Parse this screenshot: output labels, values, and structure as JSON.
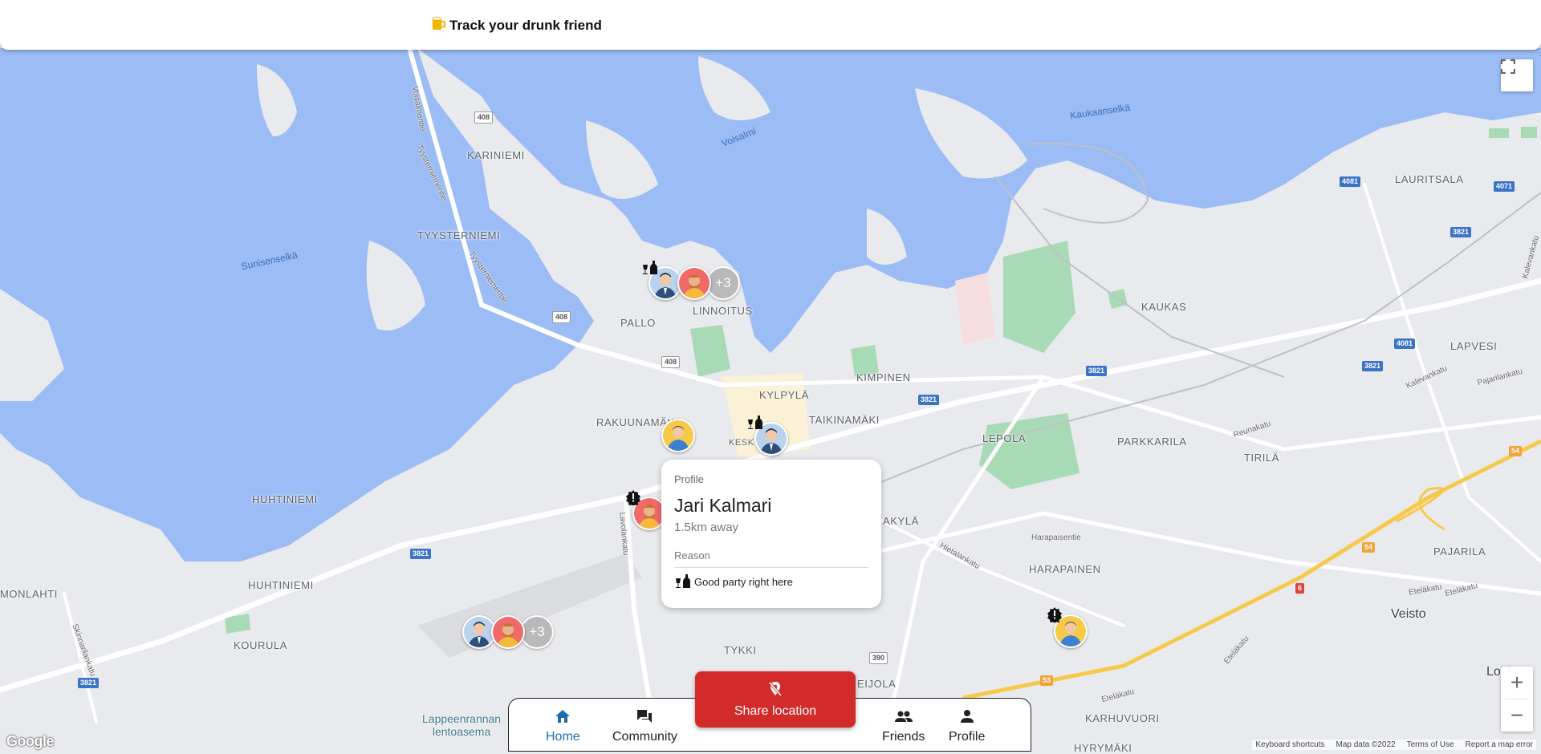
{
  "header": {
    "title": "Track your drunk friend",
    "icon": "beer-mug-icon"
  },
  "map": {
    "places": {
      "karinniemi": "KARINIEMI",
      "tyysterniemi": "TYYSTERNIEMI",
      "pallo": "PALLO",
      "linnoitus": "LINNOITUS",
      "kylpyla": "KYLPYLÄ",
      "kimpinen": "KIMPINEN",
      "rakuunamaki": "RAKUUNAMÄKI",
      "taikinamaki": "TAIKINAMÄKI",
      "keskusta": "KESKU",
      "lepola": "LEPOLA",
      "parkkarila": "PARKKARILA",
      "tirila": "TIRILÄ",
      "huhtiniemi_n": "HUHTINIEMI",
      "huhtiniemi_s": "HUHTINIEMI",
      "monlahti": "MONLAHTI",
      "kourula": "KOURULA",
      "tykki": "TYKKI",
      "eijola": "EIJOLA",
      "akyla": "AKYLÄ",
      "harapainen": "HARAPAINEN",
      "kaukas": "KAUKAS",
      "lauritsala": "LAURITSALA",
      "lapvesi": "LAPVESI",
      "pajarila": "PAJARILA",
      "karhuvuori": "KARHUVUORI",
      "hyrymaki": "HYRYMÄKI",
      "veisto": "Veisto",
      "loiri": "Loiri",
      "airport_line1": "Lappeenrannan",
      "airport_line2": "lentoasema"
    },
    "water": {
      "sunisenselka": "Sunisenselkä",
      "voisalmi": "Voisalmi",
      "kaukaanselka": "Kaukaanselkä"
    },
    "roads": {
      "voisalmentie": "Voisalmentie",
      "tyysterniementie1": "Tyysterniementie",
      "tyysterniementie2": "Tyysterniementie",
      "lavolankatu": "Lavolankatu",
      "skinnarilankatu": "Skinnarilankatu",
      "hietalankatu": "Hietalankatu",
      "harapaisentie": "Harapaisentie",
      "reunakatu": "Reunakatu",
      "kalevankatu": "Kalevankatu",
      "pajarilankatu": "Pajarilankatu",
      "etelakatu1": "Eteläkatu",
      "etelakatu2": "Eteläkatu",
      "etelakatu3": "Eteläkatu",
      "etelakatu4": "Eteläkatu",
      "kalevankatu2": "Kalevankatu"
    },
    "shields": {
      "s408a": "408",
      "s408b": "408",
      "s408c": "408",
      "s3821a": "3821",
      "s3821b": "3821",
      "s3821c": "3821",
      "s3821d": "3821",
      "s3821e": "3821",
      "s4081a": "4081",
      "s4081b": "4081",
      "s4071": "4071",
      "s390": "390",
      "s54a": "54",
      "s54b": "54",
      "s6": "6",
      "s53": "53",
      "s3821f": "3821"
    },
    "cluster_more": "+3",
    "cluster_more2": "+3",
    "attribution": [
      "Keyboard shortcuts",
      "Map data ©2022",
      "Terms of Use",
      "Report a map error"
    ],
    "logo": "Google",
    "zoom_in": "+",
    "zoom_out": "−"
  },
  "popup": {
    "kicker": "Profile",
    "name": "Jari Kalmari",
    "distance": "1.5km away",
    "reason_label": "Reason",
    "reason": "Good party right here"
  },
  "share_button": {
    "label": "Share location",
    "icon": "location-off-icon"
  },
  "nav": {
    "home": "Home",
    "community": "Community",
    "friends": "Friends",
    "profile": "Profile"
  },
  "colors": {
    "water": "#9bbcf5",
    "land": "#e8eaed",
    "park": "#a8dab5",
    "accent": "#1a6fa8",
    "share": "#d32a2a"
  }
}
